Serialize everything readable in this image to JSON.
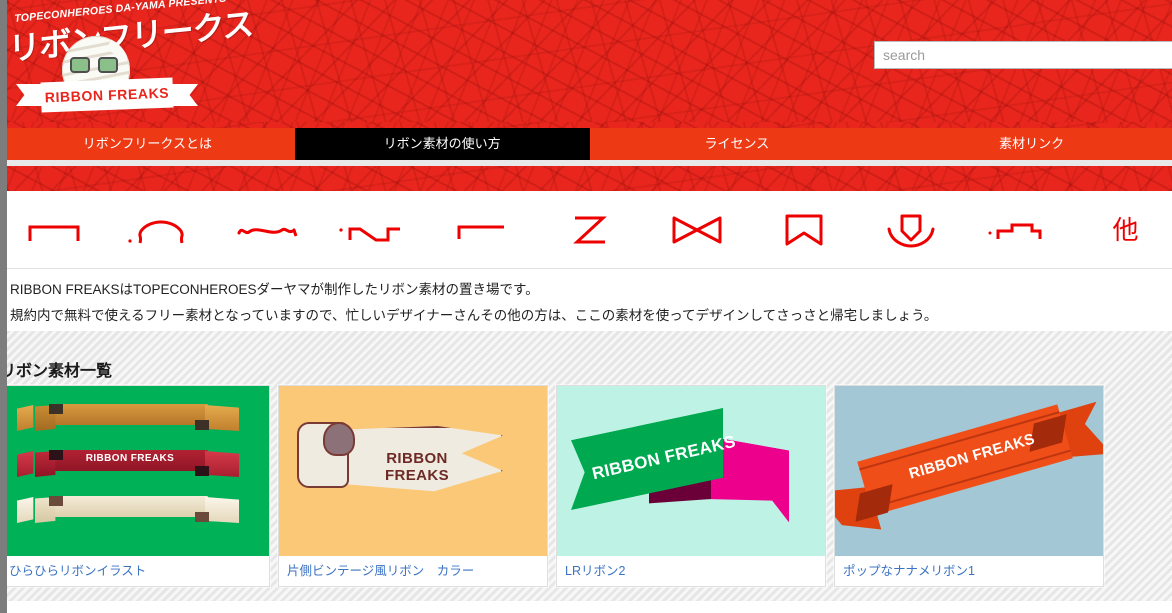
{
  "site": {
    "presents_text": "TOPECONHEROES DA-YAMA PRESENTS",
    "logo_kana": "リボンフリークス",
    "banner_text": "RIBBON FREAKS"
  },
  "search": {
    "placeholder": "search",
    "value": ""
  },
  "nav": {
    "items": [
      {
        "label": "リボンフリークスとは",
        "active": false
      },
      {
        "label": "リボン素材の使い方",
        "active": true
      },
      {
        "label": "ライセンス",
        "active": false
      },
      {
        "label": "素材リンク",
        "active": false
      }
    ]
  },
  "category_icons": [
    {
      "name": "flat-ribbon-icon"
    },
    {
      "name": "arched-ribbon-icon"
    },
    {
      "name": "wavy-ribbon-icon"
    },
    {
      "name": "zigzag-ribbon-icon"
    },
    {
      "name": "corner-ribbon-icon"
    },
    {
      "name": "z-fold-ribbon-icon"
    },
    {
      "name": "bowtie-ribbon-icon"
    },
    {
      "name": "bookmark-ribbon-icon"
    },
    {
      "name": "badge-ribbon-icon"
    },
    {
      "name": "step-ribbon-icon"
    },
    {
      "name": "other-icon",
      "label": "他"
    }
  ],
  "intro": {
    "line1": "RIBBON FREAKSはTOPECONHEROESダーヤマが制作したリボン素材の置き場です。",
    "line2": "規約内で無料で使えるフリー素材となっていますので、忙しいデザイナーさんその他の方は、ここの素材を使ってデザインしてさっさと帰宅しましょう。"
  },
  "section": {
    "title": "リボン素材一覧"
  },
  "cards": [
    {
      "caption": "ひらひらリボンイラスト",
      "bg": "#00b158",
      "ribbon_text": "RIBBON FREAKS",
      "style": "wavy"
    },
    {
      "caption": "片側ビンテージ風リボン　カラー",
      "bg": "#fbc878",
      "ribbon_text": "RIBBON FREAKS",
      "style": "vintage"
    },
    {
      "caption": "LRリボン2",
      "bg": "#bdf2e4",
      "ribbon_text": "RIBBON FREAKS",
      "style": "lr"
    },
    {
      "caption": "ポップなナナメリボン1",
      "bg": "#a3c7d4",
      "ribbon_text": "RIBBON FREAKS",
      "style": "pop"
    }
  ],
  "colors": {
    "brand_red": "#e8261d",
    "nav_red": "#ee3a14",
    "nav_active": "#000000",
    "icon_red": "#ee0000",
    "link_blue": "#3b73c4"
  }
}
